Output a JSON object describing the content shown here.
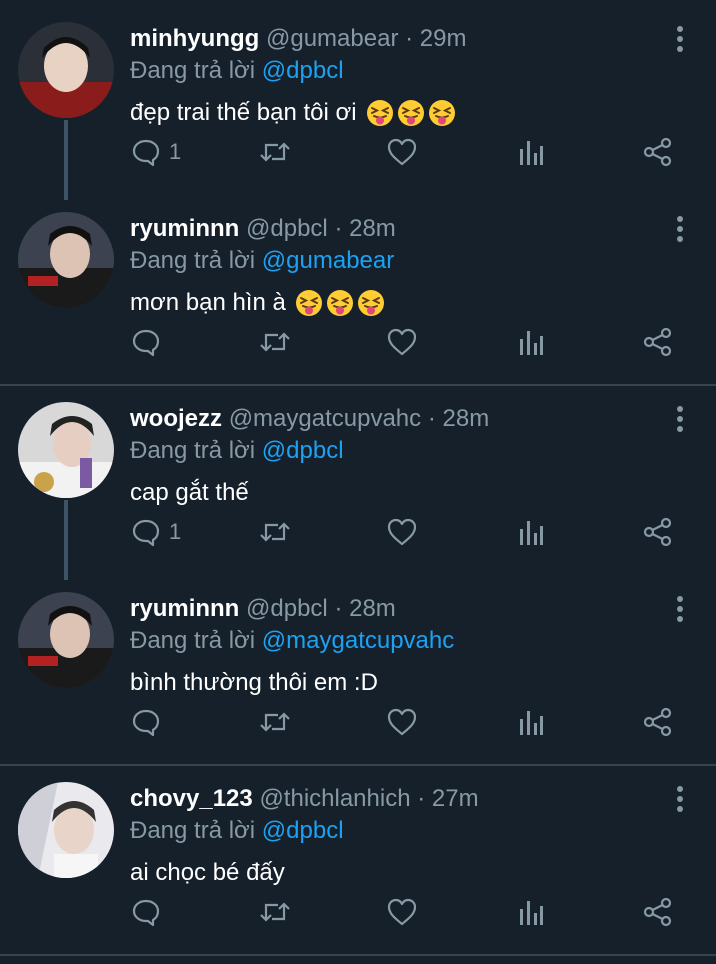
{
  "reply_prefix": "Đang trả lời",
  "tweets": [
    {
      "name": "minhyungg",
      "handle": "@gumabear",
      "time": "29m",
      "reply_to": "@dpbcl",
      "text": "đẹp trai thế bạn tôi ơi",
      "emoji_count": 3,
      "reply_count": "1"
    },
    {
      "name": "ryuminnn",
      "handle": "@dpbcl",
      "time": "28m",
      "reply_to": "@gumabear",
      "text": "mơn bạn hìn à",
      "emoji_count": 3,
      "reply_count": ""
    },
    {
      "name": "woojezz",
      "handle": "@maygatcupvahc",
      "time": "28m",
      "reply_to": "@dpbcl",
      "text": "cap gắt thế",
      "emoji_count": 0,
      "reply_count": "1"
    },
    {
      "name": "ryuminnn",
      "handle": "@dpbcl",
      "time": "28m",
      "reply_to": "@maygatcupvahc",
      "text": "bình thường thôi em :D",
      "emoji_count": 0,
      "reply_count": ""
    },
    {
      "name": "chovy_123",
      "handle": "@thichlanhich",
      "time": "27m",
      "reply_to": "@dpbcl",
      "text": "ai chọc bé đấy",
      "emoji_count": 0,
      "reply_count": ""
    }
  ],
  "colors": {
    "background": "#15202b",
    "secondary": "#8899a6",
    "mention": "#1da1f2",
    "divider": "#38444d",
    "thread_line": "#3d5466"
  },
  "icons": {
    "reply": "reply-icon",
    "retweet": "retweet-icon",
    "like": "heart-icon",
    "analytics": "analytics-icon",
    "share": "share-icon",
    "more": "more-vertical-icon",
    "emoji": "squinting-tongue-emoji"
  }
}
